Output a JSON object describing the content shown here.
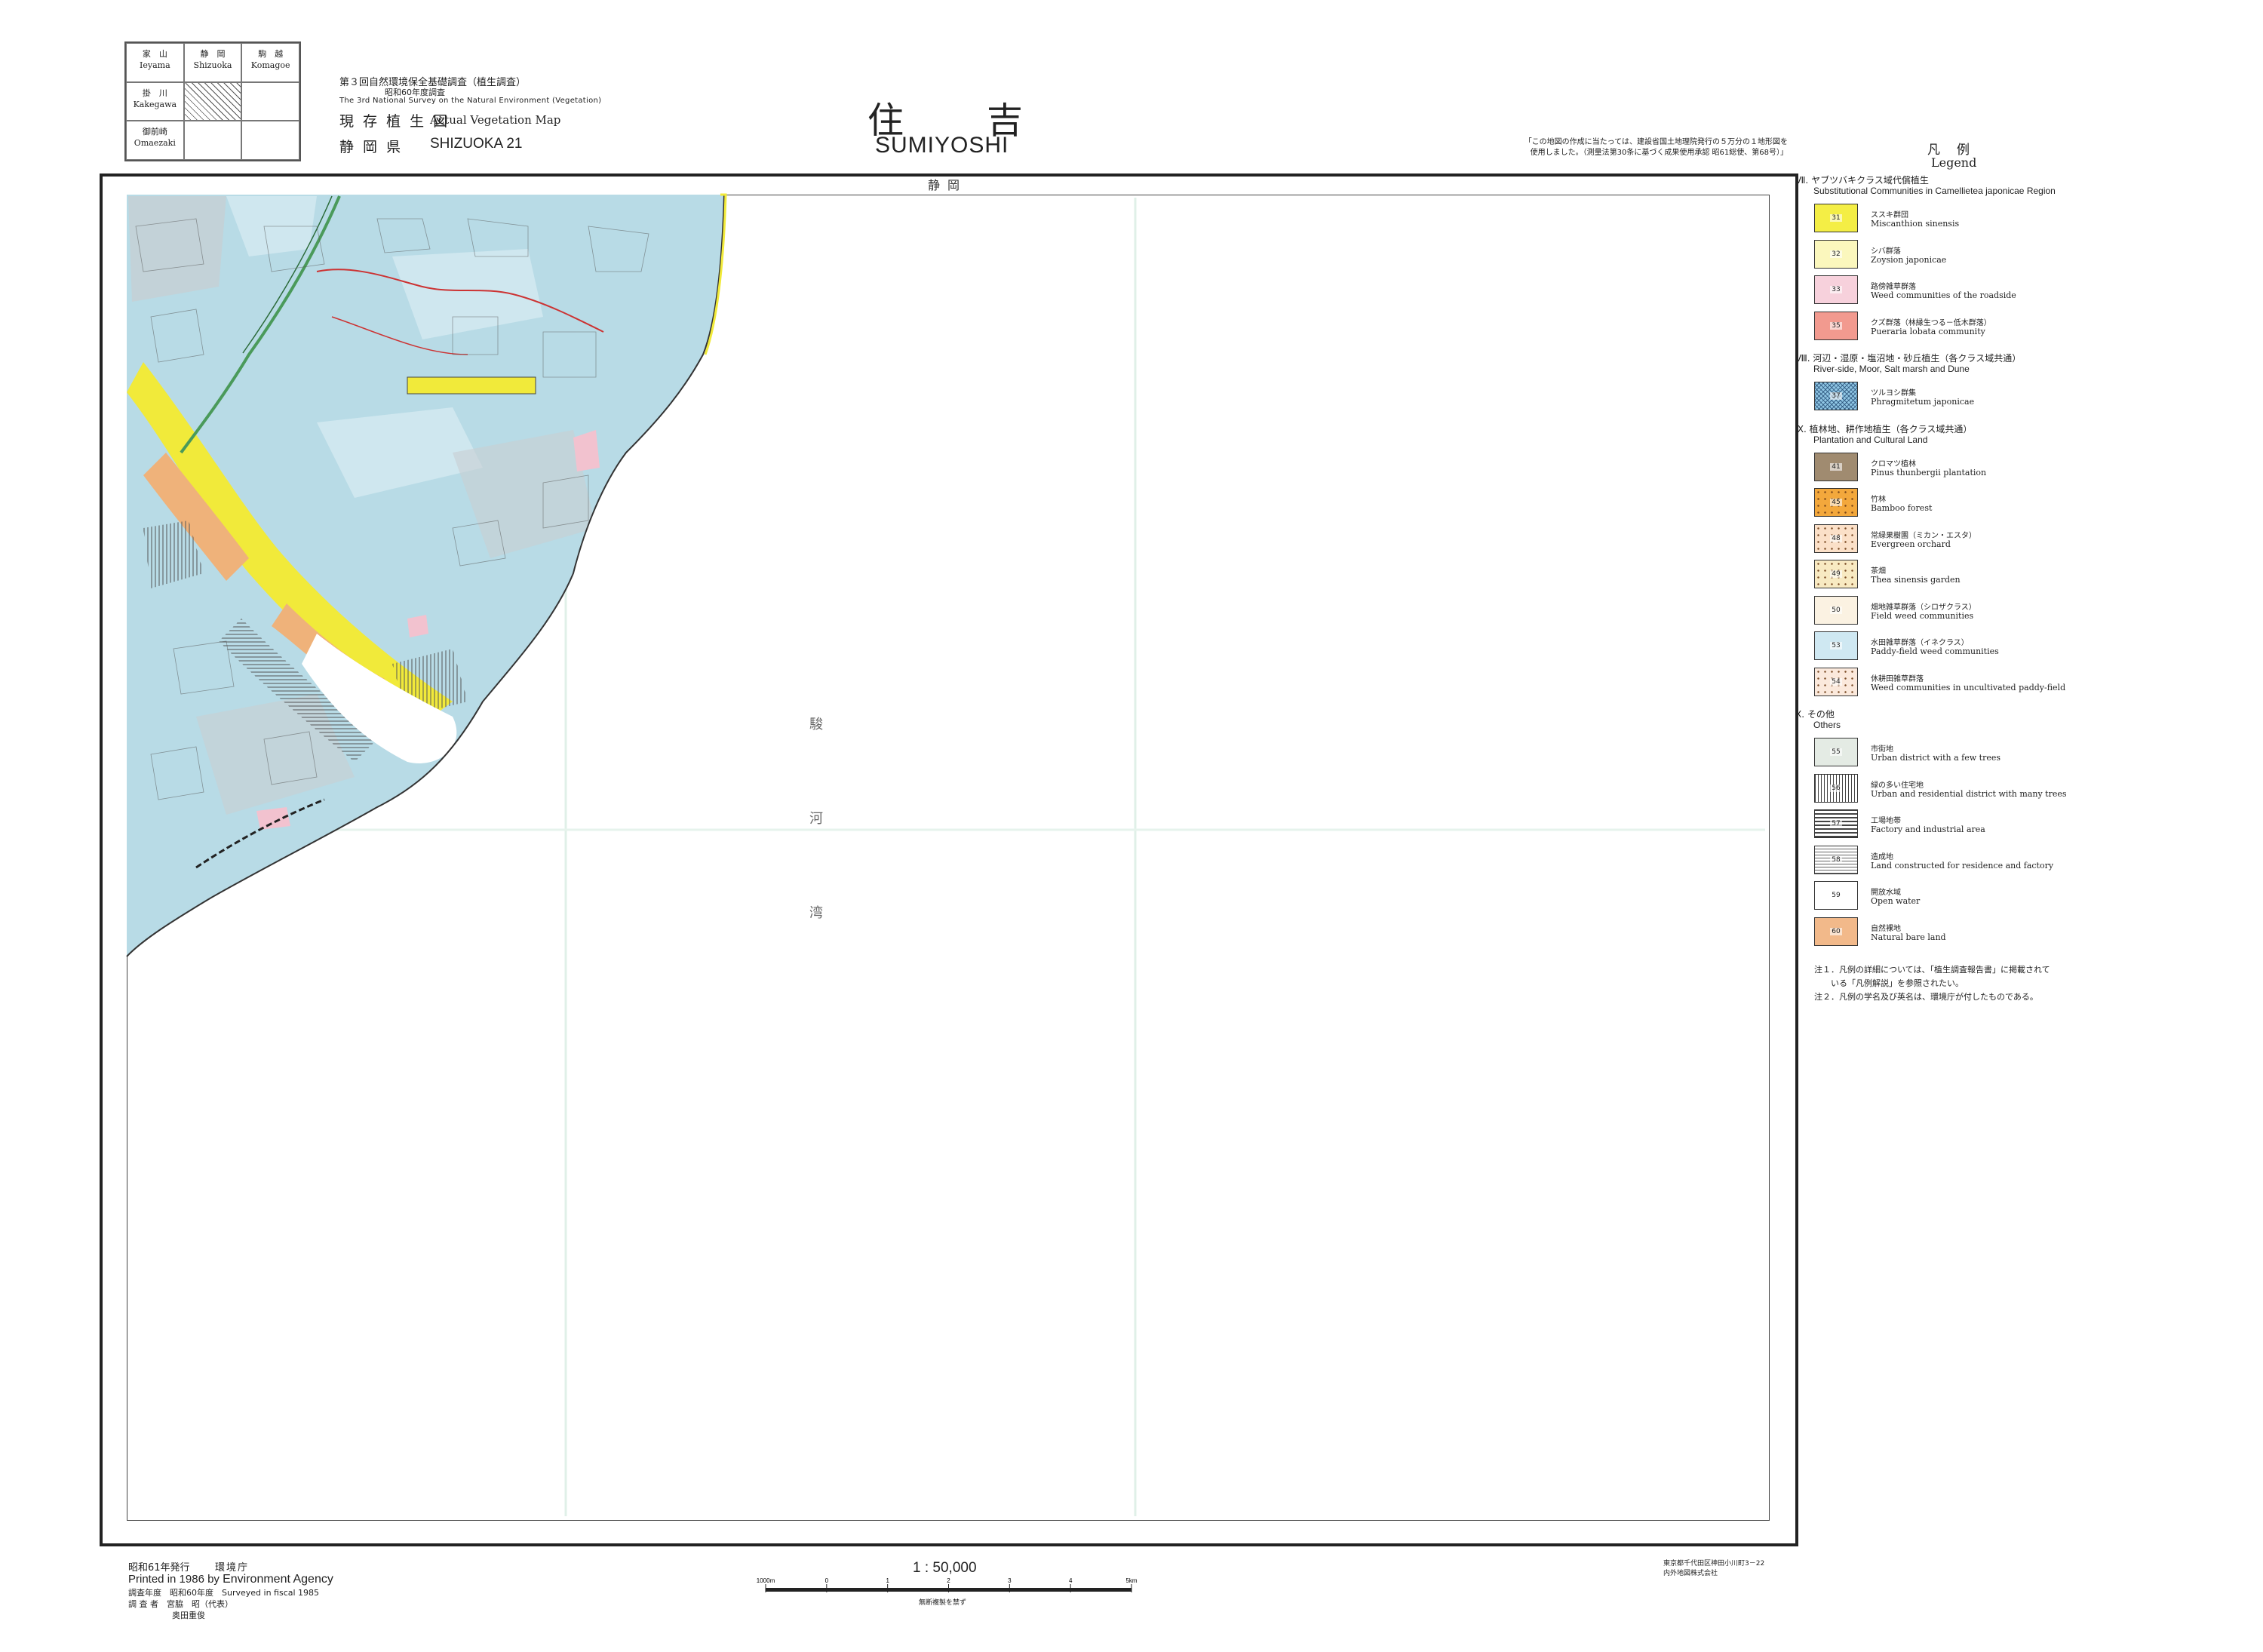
{
  "index_sheets": [
    {
      "ja": "家　山",
      "en": "Ieyama"
    },
    {
      "ja": "静　岡",
      "en": "Shizuoka"
    },
    {
      "ja": "駒　越",
      "en": "Komagoe"
    },
    {
      "ja": "掛　川",
      "en": "Kakegawa"
    },
    {
      "ja": "",
      "en": ""
    },
    {
      "ja": "",
      "en": ""
    },
    {
      "ja": "御前崎",
      "en": "Omaezaki"
    },
    {
      "ja": "",
      "en": ""
    },
    {
      "ja": "",
      "en": ""
    }
  ],
  "header": {
    "survey_line1": "第３回自然環境保全基礎調査（植生調査）",
    "survey_line2": "昭和60年度調査",
    "survey_line3": "The 3rd National Survey on the Natural Environment (Vegetation)",
    "map_kind_ja": "現 存 植 生 図",
    "map_kind_en": "Actual Vegetation Map",
    "prefecture_ja": "静 岡 県",
    "prefecture_en": "SHIZUOKA 21",
    "sheet_title_ja": "住吉",
    "sheet_title_en": "SUMIYOSHI",
    "note_top_line1": "「この地図の作成に当たっては、建設省国土地理院発行の５万分の１地形図を",
    "note_top_line2": "使用しました。（測量法第30条に基づく成果使用承認 昭61総使、第68号）」"
  },
  "map": {
    "top_edge_label": "静岡",
    "sea_name": "駿河湾",
    "colors": {
      "urban_blue": "#b8dbe6",
      "paddy_blue": "#cfe7ef",
      "field_cream": "#f6ecd4",
      "bare_orange": "#efb27a",
      "yellow": "#f1ea3a",
      "pink": "#f2c2cf",
      "green_ink": "#4a9a5a",
      "outline": "#333333"
    }
  },
  "legend": {
    "title_ja": "凡例",
    "title_en": "Legend",
    "sections": [
      {
        "heading_ja": "Ⅶ. ヤブツバキクラス域代償植生",
        "heading_en": "Substitutional Communities in Camellietea japonicae Region",
        "items": [
          {
            "code": "31",
            "ja": "ススキ群団",
            "en": "Miscanthion sinensis",
            "color": "#f4ee45",
            "pattern": "none"
          },
          {
            "code": "32",
            "ja": "シバ群落",
            "en": "Zoysion japonicae",
            "color": "#fbf7bd",
            "pattern": "none"
          },
          {
            "code": "33",
            "ja": "路傍雑草群落",
            "en": "Weed communities of the roadside",
            "color": "#f7d1dc",
            "pattern": "none"
          },
          {
            "code": "35",
            "ja": "クズ群落（林縁生つる－低木群落）",
            "en": "Pueraria lobata community",
            "color": "#f29a8f",
            "pattern": "none"
          }
        ]
      },
      {
        "heading_ja": "Ⅷ. 河辺・湿原・塩沼地・砂丘植生（各クラス域共通）",
        "heading_en": "River-side, Moor, Salt marsh and Dune",
        "items": [
          {
            "code": "37",
            "ja": "ツルヨシ群集",
            "en": "Phragmitetum japonicae",
            "color": "#8fc6e4",
            "pattern": "cross"
          }
        ]
      },
      {
        "heading_ja": "Ⅸ. 植林地、耕作地植生（各クラス域共通）",
        "heading_en": "Plantation and Cultural Land",
        "items": [
          {
            "code": "41",
            "ja": "クロマツ植林",
            "en": "Pinus thunbergii plantation",
            "color": "#a08b70",
            "pattern": "none"
          },
          {
            "code": "45",
            "ja": "竹林",
            "en": "Bamboo forest",
            "color": "#f3a83c",
            "pattern": "dots"
          },
          {
            "code": "48",
            "ja": "常緑果樹園（ミカン・エスタ）",
            "en": "Evergreen orchard",
            "color": "#fbe0c8",
            "pattern": "dots"
          },
          {
            "code": "49",
            "ja": "茶畑",
            "en": "Thea sinensis garden",
            "color": "#f8eac2",
            "pattern": "dots"
          },
          {
            "code": "50",
            "ja": "畑地雑草群落（シロザクラス）",
            "en": "Field weed communities",
            "color": "#fbf2e2",
            "pattern": "none"
          },
          {
            "code": "53",
            "ja": "水田雑草群落（イネクラス）",
            "en": "Paddy-field weed communities",
            "color": "#cfe8f2",
            "pattern": "none"
          },
          {
            "code": "54",
            "ja": "休耕田雑草群落",
            "en": "Weed communities in uncultivated paddy-field",
            "color": "#fbe9dc",
            "pattern": "dots"
          }
        ]
      },
      {
        "heading_ja": "Ⅹ. その他",
        "heading_en": "Others",
        "items": [
          {
            "code": "55",
            "ja": "市街地",
            "en": "Urban district with a few trees",
            "color": "#e4ebe4",
            "pattern": "none"
          },
          {
            "code": "56",
            "ja": "緑の多い住宅地",
            "en": "Urban and residential district with many trees",
            "color": "#ffffff",
            "pattern": "vlines"
          },
          {
            "code": "57",
            "ja": "工場地帯",
            "en": "Factory and industrial area",
            "color": "#ffffff",
            "pattern": "hlines"
          },
          {
            "code": "58",
            "ja": "造成地",
            "en": "Land constructed for residence and factory",
            "color": "#ffffff",
            "pattern": "hlines2"
          },
          {
            "code": "59",
            "ja": "開放水域",
            "en": "Open water",
            "color": "#ffffff",
            "pattern": "none"
          },
          {
            "code": "60",
            "ja": "自然裸地",
            "en": "Natural bare land",
            "color": "#f2b98a",
            "pattern": "none"
          }
        ]
      }
    ],
    "note1": "注１．凡例の詳細については、「植生調査報告書」に掲載されて",
    "note1b": "　　いる「凡例解説」を参照されたい。",
    "note2": "注２．凡例の学名及び英名は、環境庁が付したものである。"
  },
  "footer": {
    "pub_date": "昭和61年発行",
    "publisher_ja": "環境庁",
    "printed_prefix": "Printed in 1986 by ",
    "publisher_en": "Environment Agency",
    "survey_year": "調査年度　昭和60年度　Surveyed in fiscal 1985",
    "surveyor": "調 査 者　宮脇　昭（代表）",
    "surveyor2": "奥田重俊",
    "scale": "1 : 50,000",
    "scale_ticks": [
      "1000m",
      "0",
      "1",
      "2",
      "3",
      "4",
      "5km"
    ],
    "reprint_note": "無断複製を禁ず",
    "printer_line1": "東京都千代田区神田小川町3－22",
    "printer_line2": "内外地図株式会社"
  }
}
